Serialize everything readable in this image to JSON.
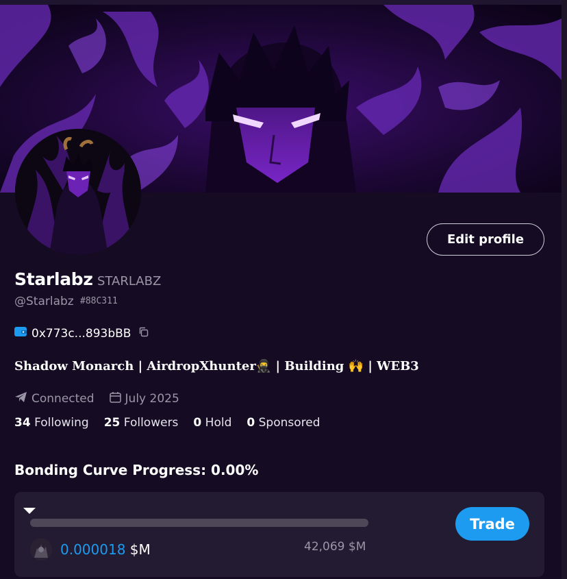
{
  "profile": {
    "name": "Starlabz",
    "ticker": "STARLABZ",
    "handle": "@Starlabz",
    "tag": "#88C311",
    "wallet": "0x773c...893bBB",
    "bio": "Shadow Monarch | AirdropXhunter🥷 | Building 🙌 | WEB3",
    "connection": "Connected",
    "joined": "July 2025",
    "edit_label": "Edit profile"
  },
  "stats": [
    {
      "count": "34",
      "label": "Following"
    },
    {
      "count": "25",
      "label": "Followers"
    },
    {
      "count": "0",
      "label": "Hold"
    },
    {
      "count": "0",
      "label": "Sponsored"
    }
  ],
  "bonding": {
    "title": "Bonding Curve Progress: 0.00%",
    "progress_percent": 0,
    "price_value": "0.000018",
    "price_unit": "$M",
    "market_cap": "42,069 $M",
    "trade_label": "Trade"
  },
  "colors": {
    "background": "#150c23",
    "accent": "#1d9bf0",
    "card": "#231b31",
    "muted_text": "#9b97a6",
    "banner_purple": "#8a2be2"
  },
  "icons": [
    "wallet-icon",
    "copy-icon",
    "telegram-icon",
    "calendar-icon",
    "chevron-down-icon"
  ]
}
